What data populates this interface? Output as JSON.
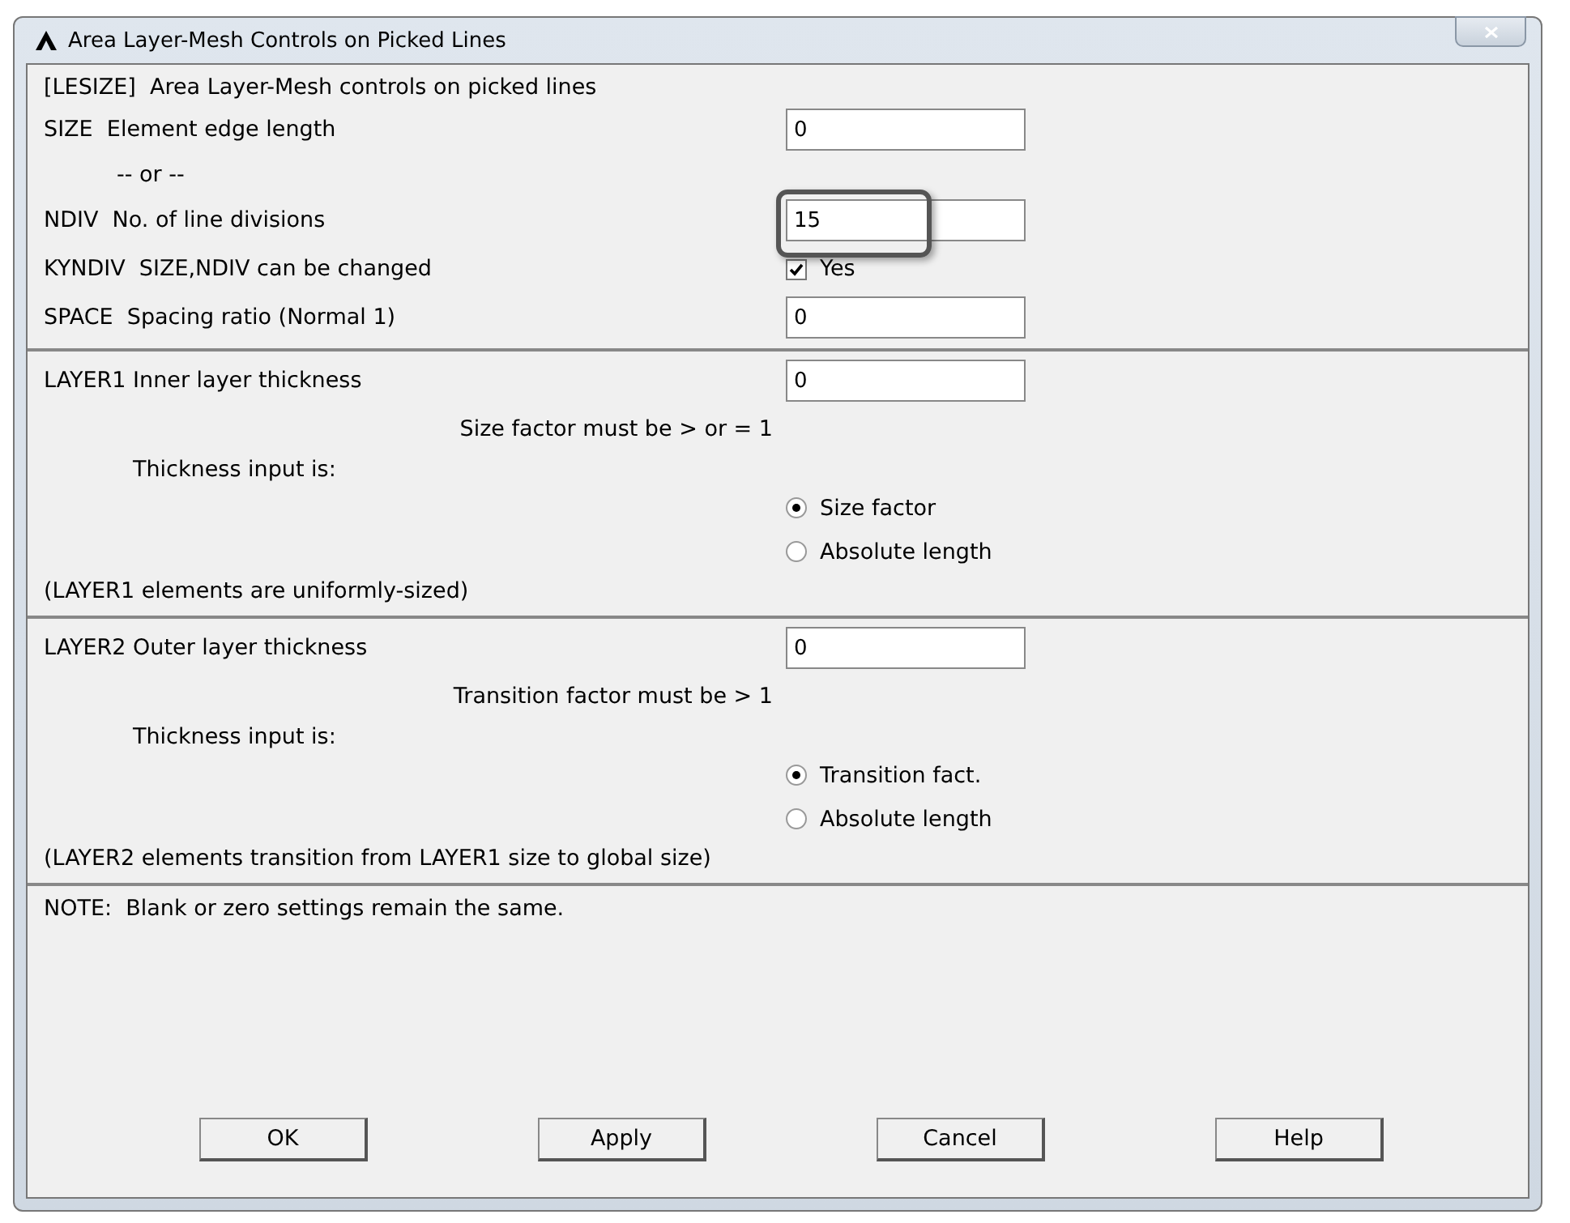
{
  "window": {
    "title": "Area Layer-Mesh Controls on Picked Lines"
  },
  "sections": [
    {
      "rows": [
        {
          "kind": "note",
          "text": "[LESIZE]  Area Layer-Mesh controls on picked lines"
        },
        {
          "kind": "field",
          "label": "SIZE  Element edge length",
          "value": "0",
          "highlighted": false
        },
        {
          "kind": "or",
          "text": "-- or --"
        },
        {
          "kind": "field",
          "label": "NDIV  No. of line divisions",
          "value": "15",
          "highlighted": true
        },
        {
          "kind": "checkbox",
          "label": "KYNDIV  SIZE,NDIV can be changed",
          "option": "Yes",
          "checked": true
        },
        {
          "kind": "field",
          "label": "SPACE  Spacing ratio (Normal 1)",
          "value": "0",
          "highlighted": false
        }
      ]
    },
    {
      "rows": [
        {
          "kind": "field",
          "label": "LAYER1 Inner layer thickness",
          "value": "0",
          "highlighted": false
        },
        {
          "kind": "hint",
          "text": "Size factor must be > or = 1"
        },
        {
          "kind": "prompt",
          "text": "Thickness input is:"
        },
        {
          "kind": "radio",
          "option": "Size factor",
          "selected": true
        },
        {
          "kind": "radio",
          "option": "Absolute length",
          "selected": false
        },
        {
          "kind": "note",
          "text": "(LAYER1 elements are uniformly-sized)"
        }
      ]
    },
    {
      "rows": [
        {
          "kind": "field",
          "label": "LAYER2 Outer layer thickness",
          "value": "0",
          "highlighted": false
        },
        {
          "kind": "hint",
          "text": "Transition factor must be > 1"
        },
        {
          "kind": "prompt",
          "text": "Thickness input is:"
        },
        {
          "kind": "radio",
          "option": "Transition fact.",
          "selected": true
        },
        {
          "kind": "radio",
          "option": "Absolute length",
          "selected": false
        },
        {
          "kind": "note",
          "text": "(LAYER2 elements transition from LAYER1 size to global size)"
        }
      ]
    }
  ],
  "note": "NOTE:  Blank or zero settings remain the same.",
  "buttons": [
    "OK",
    "Apply",
    "Cancel",
    "Help"
  ]
}
